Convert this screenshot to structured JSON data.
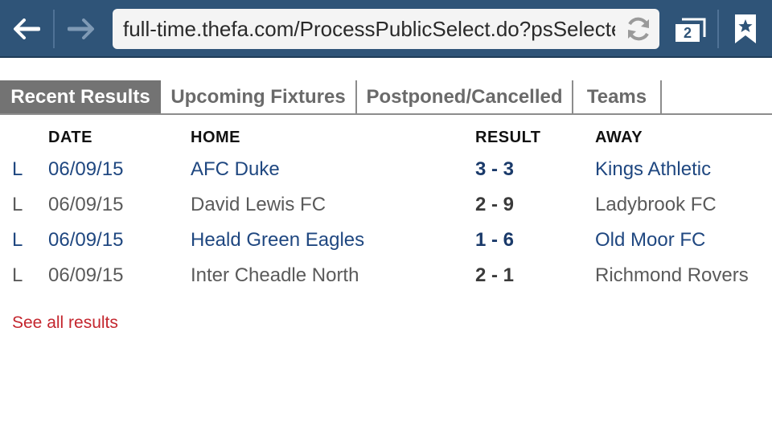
{
  "browser": {
    "url": "full-time.thefa.com/ProcessPublicSelect.do?psSelectedSeason",
    "tab_count": "2",
    "icons": {
      "back": "back-arrow-icon",
      "forward": "forward-arrow-icon",
      "reload": "reload-icon",
      "tabs": "tabs-icon",
      "bookmark": "bookmark-star-icon"
    },
    "colors": {
      "toolbar": "#2f5478",
      "url_bar": "#f4f4f4"
    }
  },
  "tabs": [
    {
      "label": "Recent Results",
      "active": true
    },
    {
      "label": "Upcoming Fixtures",
      "active": false
    },
    {
      "label": "Postponed/Cancelled",
      "active": false
    },
    {
      "label": "Teams",
      "active": false
    }
  ],
  "table": {
    "headers": {
      "date": "DATE",
      "home": "HOME",
      "result": "RESULT",
      "away": "AWAY"
    },
    "rows": [
      {
        "flag": "L",
        "date": "06/09/15",
        "home": "AFC Duke",
        "result": "3 - 3",
        "away": "Kings Athletic",
        "linked": true
      },
      {
        "flag": "L",
        "date": "06/09/15",
        "home": "David Lewis FC",
        "result": "2 - 9",
        "away": "Ladybrook FC",
        "linked": false
      },
      {
        "flag": "L",
        "date": "06/09/15",
        "home": "Heald Green Eagles",
        "result": "1 - 6",
        "away": "Old Moor FC",
        "linked": true
      },
      {
        "flag": "L",
        "date": "06/09/15",
        "home": "Inter Cheadle North",
        "result": "2 - 1",
        "away": "Richmond Rovers",
        "linked": false
      }
    ]
  },
  "see_all": {
    "label": "See all results",
    "color": "#c4262e"
  }
}
